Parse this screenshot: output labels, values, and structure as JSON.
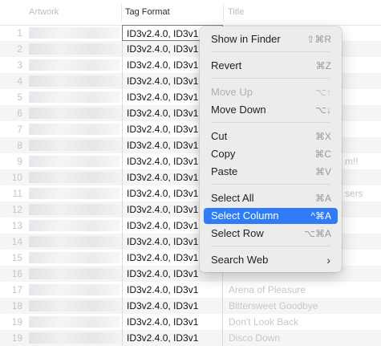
{
  "columns": {
    "artwork": "Artwork",
    "tag_format": "Tag Format",
    "title": "Title"
  },
  "rows": [
    {
      "num": "1",
      "tag": "ID3v2.4.0, ID3v1",
      "title": ""
    },
    {
      "num": "2",
      "tag": "ID3v2.4.0, ID3v1",
      "title": ""
    },
    {
      "num": "3",
      "tag": "ID3v2.4.0, ID3v1",
      "title": ""
    },
    {
      "num": "4",
      "tag": "ID3v2.4.0, ID3v1",
      "title": ""
    },
    {
      "num": "5",
      "tag": "ID3v2.4.0, ID3v1",
      "title": ""
    },
    {
      "num": "6",
      "tag": "ID3v2.4.0, ID3v1",
      "title": ""
    },
    {
      "num": "7",
      "tag": "ID3v2.4.0, ID3v1",
      "title": ""
    },
    {
      "num": "8",
      "tag": "ID3v2.4.0, ID3v1",
      "title": ""
    },
    {
      "num": "9",
      "tag": "ID3v2.4.0, ID3v1",
      "title": "m!!"
    },
    {
      "num": "10",
      "tag": "ID3v2.4.0, ID3v1",
      "title": ""
    },
    {
      "num": "11",
      "tag": "ID3v2.4.0, ID3v1",
      "title": "sers"
    },
    {
      "num": "12",
      "tag": "ID3v2.4.0, ID3v1",
      "title": ""
    },
    {
      "num": "13",
      "tag": "ID3v2.4.0, ID3v1",
      "title": ""
    },
    {
      "num": "14",
      "tag": "ID3v2.4.0, ID3v1",
      "title": ""
    },
    {
      "num": "15",
      "tag": "ID3v2.4.0, ID3v1",
      "title": ""
    },
    {
      "num": "16",
      "tag": "ID3v2.4.0, ID3v1",
      "title": ""
    },
    {
      "num": "17",
      "tag": "ID3v2.4.0, ID3v1",
      "title": "Arena of Pleasure"
    },
    {
      "num": "18",
      "tag": "ID3v2.4.0, ID3v1",
      "title": "Bittersweet Goodbye"
    },
    {
      "num": "19",
      "tag": "ID3v2.4.0, ID3v1",
      "title": "Don't Look Back"
    },
    {
      "num": "19",
      "tag": "ID3v2.4.0, ID3v1",
      "title": "Disco Down"
    }
  ],
  "context_menu": {
    "show_in_finder": {
      "label": "Show in Finder",
      "shortcut": "⇧⌘R"
    },
    "revert": {
      "label": "Revert",
      "shortcut": "⌘Z"
    },
    "move_up": {
      "label": "Move Up",
      "shortcut": "⌥↑"
    },
    "move_down": {
      "label": "Move Down",
      "shortcut": "⌥↓"
    },
    "cut": {
      "label": "Cut",
      "shortcut": "⌘X"
    },
    "copy": {
      "label": "Copy",
      "shortcut": "⌘C"
    },
    "paste": {
      "label": "Paste",
      "shortcut": "⌘V"
    },
    "select_all": {
      "label": "Select All",
      "shortcut": "⌘A"
    },
    "select_column": {
      "label": "Select Column",
      "shortcut": "^⌘A"
    },
    "select_row": {
      "label": "Select Row",
      "shortcut": "⌥⌘A"
    },
    "search_web": {
      "label": "Search Web",
      "submenu_icon": "chevron-right-icon"
    }
  },
  "colors": {
    "highlight": "#2f7cf6",
    "menu_bg": "#ececec",
    "alt_row": "#f5f5f5"
  }
}
